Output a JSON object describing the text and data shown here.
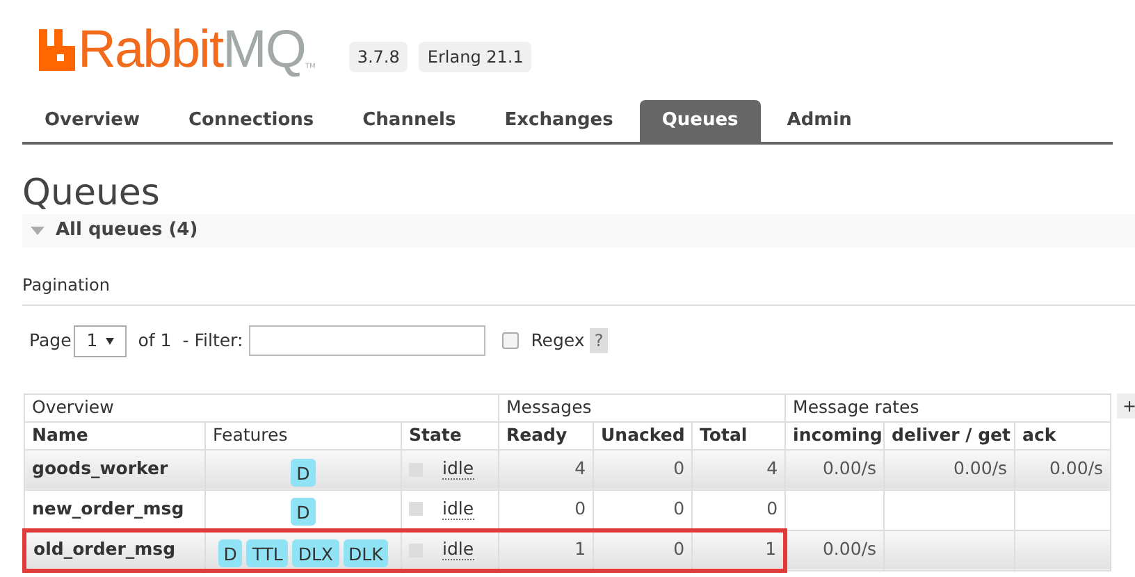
{
  "header": {
    "logo": {
      "brand_primary": "Rabbit",
      "brand_secondary": "MQ",
      "trademark": "TM"
    },
    "badges": [
      "3.7.8",
      "Erlang 21.1"
    ]
  },
  "tabs": [
    {
      "label": "Overview",
      "selected": false
    },
    {
      "label": "Connections",
      "selected": false
    },
    {
      "label": "Channels",
      "selected": false
    },
    {
      "label": "Exchanges",
      "selected": false
    },
    {
      "label": "Queues",
      "selected": true
    },
    {
      "label": "Admin",
      "selected": false
    }
  ],
  "page_title": "Queues",
  "section": {
    "title": "All queues (4)",
    "expanded": true
  },
  "pagination": {
    "title": "Pagination",
    "page_label": "Page",
    "page_value": "1",
    "of_label": "of 1",
    "filter_label": "- Filter:",
    "regex_label": "Regex",
    "regex_checked": false,
    "help": "?"
  },
  "table": {
    "groups": [
      {
        "label": "Overview"
      },
      {
        "label": "Messages"
      },
      {
        "label": "Message rates"
      }
    ],
    "add_button": "+",
    "columns": [
      {
        "label": "Name",
        "bold": true
      },
      {
        "label": "Features",
        "bold": false
      },
      {
        "label": "State",
        "bold": true
      },
      {
        "label": "Ready",
        "bold": true
      },
      {
        "label": "Unacked",
        "bold": true
      },
      {
        "label": "Total",
        "bold": true
      },
      {
        "label": "incoming",
        "bold": true
      },
      {
        "label": "deliver / get",
        "bold": true
      },
      {
        "label": "ack",
        "bold": true
      }
    ],
    "rows": [
      {
        "name": "goods_worker",
        "features": [
          "D"
        ],
        "state": "idle",
        "ready": "4",
        "unacked": "0",
        "total": "4",
        "incoming": "0.00/s",
        "deliver_get": "0.00/s",
        "ack": "0.00/s",
        "highlighted": false
      },
      {
        "name": "new_order_msg",
        "features": [
          "D"
        ],
        "state": "idle",
        "ready": "0",
        "unacked": "0",
        "total": "0",
        "highlighted": false
      },
      {
        "name": "old_order_msg",
        "features": [
          "D",
          "TTL",
          "DLX",
          "DLK"
        ],
        "state": "idle",
        "ready": "1",
        "unacked": "0",
        "total": "1",
        "incoming": "0.00/s",
        "highlighted": true
      }
    ]
  }
}
